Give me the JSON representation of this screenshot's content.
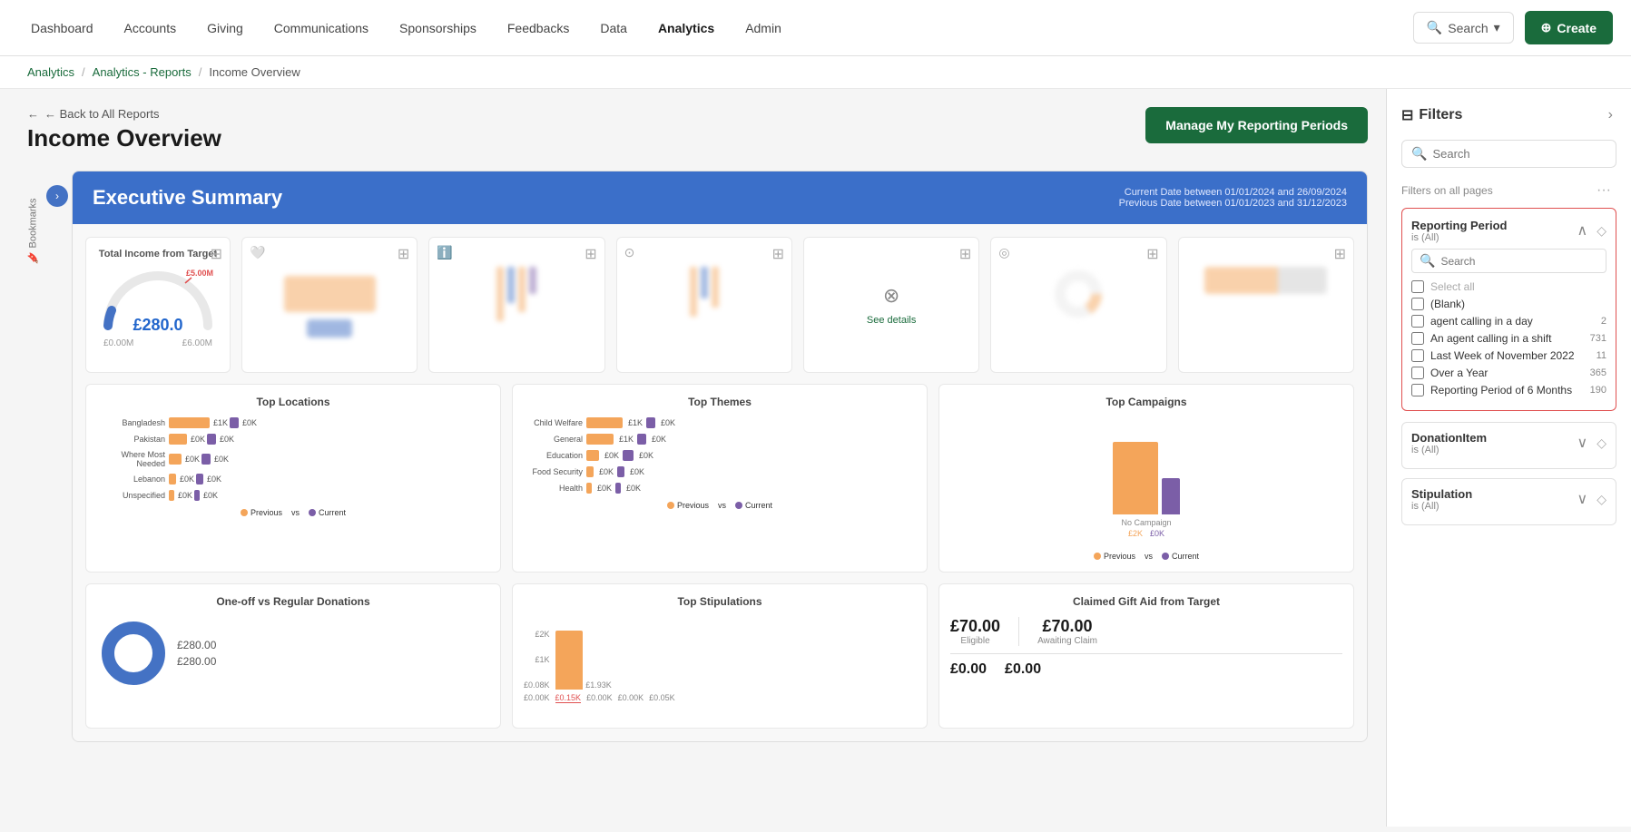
{
  "nav": {
    "items": [
      {
        "label": "Dashboard",
        "active": false
      },
      {
        "label": "Accounts",
        "active": false
      },
      {
        "label": "Giving",
        "active": false
      },
      {
        "label": "Communications",
        "active": false
      },
      {
        "label": "Sponsorships",
        "active": false
      },
      {
        "label": "Feedbacks",
        "active": false
      },
      {
        "label": "Data",
        "active": false
      },
      {
        "label": "Analytics",
        "active": true
      },
      {
        "label": "Admin",
        "active": false
      }
    ],
    "search_label": "Search",
    "create_label": "Create"
  },
  "breadcrumb": {
    "items": [
      {
        "label": "Analytics",
        "link": true
      },
      {
        "label": "Analytics - Reports",
        "link": true
      },
      {
        "label": "Income Overview",
        "link": false
      }
    ]
  },
  "page": {
    "back_label": "← Back to All Reports",
    "title": "Income Overview",
    "manage_btn": "Manage My Reporting Periods"
  },
  "dashboard": {
    "exec_summary_title": "Executive Summary",
    "current_date": "Current Date between 01/01/2024 and 26/09/2024",
    "previous_date": "Previous Date between 01/01/2023 and 31/12/2023",
    "total_income_title": "Total Income from Target",
    "gauge_value": "£280.0",
    "gauge_target": "£5.00M",
    "gauge_min": "£0.00M",
    "gauge_max": "£6.00M",
    "top_locations_title": "Top Locations",
    "locations": [
      {
        "label": "Bangladesh",
        "current": 40,
        "previous": 10
      },
      {
        "label": "Pakistan",
        "current": 18,
        "previous": 8
      },
      {
        "label": "Where Most Needed",
        "current": 12,
        "previous": 8
      },
      {
        "label": "Lebanon",
        "current": 8,
        "previous": 8
      },
      {
        "label": "Unspecified",
        "current": 6,
        "previous": 6
      }
    ],
    "loc_labels": {
      "current": "£1K",
      "previous": "£0K"
    },
    "top_themes_title": "Top Themes",
    "themes": [
      {
        "label": "Child Welfare",
        "current": 40,
        "previous": 10
      },
      {
        "label": "General",
        "current": 30,
        "previous": 10
      },
      {
        "label": "Education",
        "current": 14,
        "previous": 12
      },
      {
        "label": "Food Security",
        "current": 8,
        "previous": 8
      },
      {
        "label": "Health",
        "current": 6,
        "previous": 6
      }
    ],
    "theme_labels": {
      "current": "£1K",
      "previous": "£0K"
    },
    "top_campaigns_title": "Top Campaigns",
    "campaign_label": "No Campaign",
    "campaign_bar_labels": "£2K  £0K",
    "one_off_title": "One-off vs Regular Donations",
    "one_off_value": "£280.00",
    "regular_value": "£280.00",
    "top_stipulations_title": "Top Stipulations",
    "stip_values": [
      "£2K",
      "£1K",
      "£0.08K"
    ],
    "stip_bar_val": "£1.93K",
    "stip_bottom": "£0.00K  £0.15K  £0.00K  £0.00K  £0.05K",
    "gift_aid_title": "Claimed Gift Aid from Target",
    "gift_aid_eligible": "£70.00",
    "gift_aid_awaiting": "£70.00",
    "gift_aid_eligible_label": "Eligible",
    "gift_aid_awaiting_label": "Awaiting Claim",
    "gift_aid_bottom_left": "£0.00",
    "gift_aid_bottom_right": "£0.00"
  },
  "filters": {
    "title": "Filters",
    "search_placeholder": "Search",
    "all_pages_label": "Filters on all pages",
    "reporting_period": {
      "title": "Reporting Period",
      "subtitle": "is (All)",
      "search_placeholder": "Search",
      "options": [
        {
          "label": "Select all",
          "checked": false,
          "count": null,
          "grayed": true
        },
        {
          "label": "(Blank)",
          "checked": false,
          "count": null
        },
        {
          "label": "agent calling in a day",
          "checked": false,
          "count": "2"
        },
        {
          "label": "An agent calling in a shift",
          "checked": false,
          "count": "731"
        },
        {
          "label": "Last Week of November 2022",
          "checked": false,
          "count": "11"
        },
        {
          "label": "Over a Year",
          "checked": false,
          "count": "365"
        },
        {
          "label": "Reporting Period of 6 Months",
          "checked": false,
          "count": "190"
        }
      ]
    },
    "donation_item": {
      "title": "DonationItem",
      "subtitle": "is (All)"
    },
    "stipulation": {
      "title": "Stipulation",
      "subtitle": "is (All)"
    }
  },
  "bookmarks_label": "Bookmarks"
}
